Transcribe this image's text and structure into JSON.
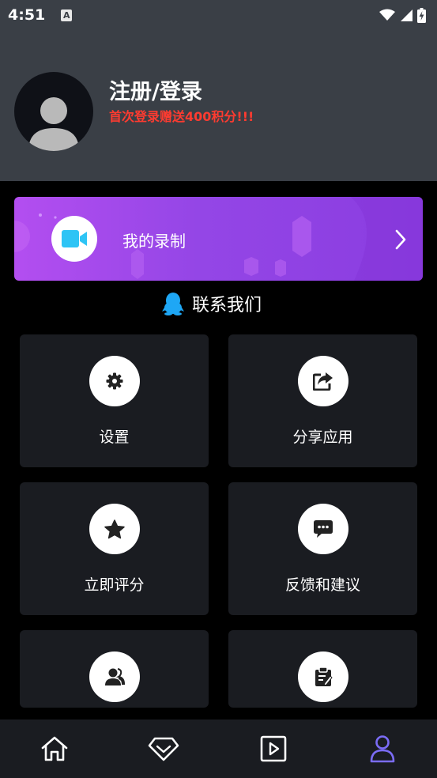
{
  "status_bar": {
    "time": "4:51",
    "notification_badge": "A",
    "icons": [
      "wifi-icon",
      "signal-icon",
      "battery-charging-icon"
    ]
  },
  "profile": {
    "title": "注册/登录",
    "subtitle": "首次登录赠送400积分!!!",
    "avatar_icon": "default-user-avatar"
  },
  "banner": {
    "label": "我的录制",
    "icon": "video-camera-icon",
    "chevron": "chevron-right-icon"
  },
  "contact": {
    "label": "联系我们",
    "icon": "qq-penguin-icon"
  },
  "grid": [
    {
      "label": "设置",
      "icon": "gear-icon"
    },
    {
      "label": "分享应用",
      "icon": "share-icon"
    },
    {
      "label": "立即评分",
      "icon": "star-icon"
    },
    {
      "label": "反馈和建议",
      "icon": "chat-icon"
    },
    {
      "label": "",
      "icon": "user-group-icon"
    },
    {
      "label": "",
      "icon": "clipboard-icon"
    }
  ],
  "bottom_nav": [
    {
      "icon": "home-icon",
      "active": false
    },
    {
      "icon": "diamond-icon",
      "active": false
    },
    {
      "icon": "play-icon",
      "active": false
    },
    {
      "icon": "profile-icon",
      "active": true
    }
  ],
  "colors": {
    "header_bg": "#3a3f46",
    "page_bg": "#000000",
    "card_bg": "#1a1c21",
    "subtitle_red": "#ff3b30",
    "accent_purple": "#8a3de0",
    "nav_active": "#7b6cf6",
    "camera_blue": "#2ec4f5",
    "qq_blue": "#1ea7f5"
  }
}
